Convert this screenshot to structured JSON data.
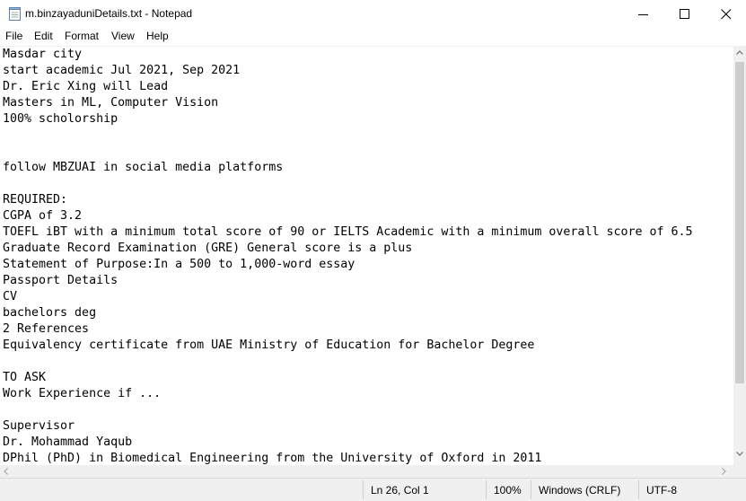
{
  "window": {
    "title": "m.binzayaduniDetails.txt - Notepad",
    "icons": {
      "app": "notepad-icon",
      "minimize": "minimize-icon",
      "maximize": "maximize-icon",
      "close": "close-icon"
    }
  },
  "menu": {
    "items": [
      "File",
      "Edit",
      "Format",
      "View",
      "Help"
    ]
  },
  "document": {
    "lines": [
      "Masdar city",
      "start academic Jul 2021, Sep 2021",
      "Dr. Eric Xing will Lead",
      "Masters in ML, Computer Vision",
      "100% scholorship",
      "",
      "",
      "follow MBZUAI in social media platforms",
      "",
      "REQUIRED:",
      "CGPA of 3.2",
      "TOEFL iBT with a minimum total score of 90 or IELTS Academic with a minimum overall score of 6.5",
      "Graduate Record Examination (GRE) General score is a plus",
      "Statement of Purpose:In a 500 to 1,000-word essay",
      "Passport Details",
      "CV",
      "bachelors deg",
      "2 References",
      "Equivalency certificate from UAE Ministry of Education for Bachelor Degree",
      "",
      "TO ASK",
      "Work Experience if ...",
      "",
      "Supervisor",
      "Dr. Mohammad Yaqub",
      "DPhil (PhD) in Biomedical Engineering from the University of Oxford in 2011"
    ]
  },
  "status": {
    "position": "Ln 26, Col 1",
    "zoom": "100%",
    "line_ending": "Windows (CRLF)",
    "encoding": "UTF-8"
  }
}
